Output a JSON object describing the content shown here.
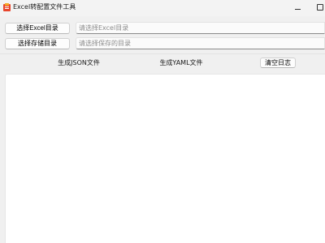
{
  "window": {
    "title": "Excel转配置文件工具",
    "icon": "app-icon"
  },
  "excel_dir": {
    "button_label": "选择Excel目录",
    "input_value": "",
    "placeholder": "请选择Excel目录"
  },
  "save_dir": {
    "button_label": "选择存储目录",
    "input_value": "",
    "placeholder": "请选择保存的目录"
  },
  "actions": {
    "json_label": "生成JSON文件",
    "yaml_label": "生成YAML文件",
    "clear_label": "清空日志"
  },
  "log": {
    "content": ""
  }
}
